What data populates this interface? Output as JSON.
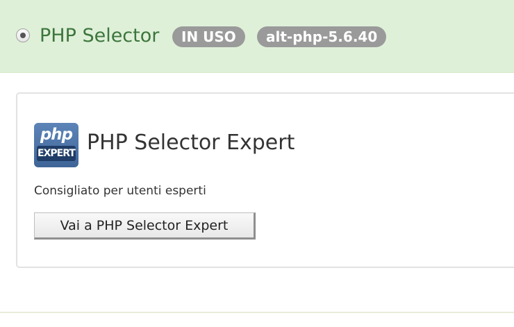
{
  "header": {
    "title": "PHP Selector",
    "badge_status": "IN USO",
    "badge_version": "alt-php-5.6.40",
    "background_color": "#dff0d8",
    "title_color": "#3c763d",
    "radio_selected": true
  },
  "card": {
    "logo": {
      "icon": "php-expert-logo-icon",
      "top_text": "php",
      "bottom_text": "EXPERT"
    },
    "title": "PHP Selector Expert",
    "description": "Consigliato per utenti esperti",
    "button_label": "Vai a PHP Selector Expert"
  }
}
